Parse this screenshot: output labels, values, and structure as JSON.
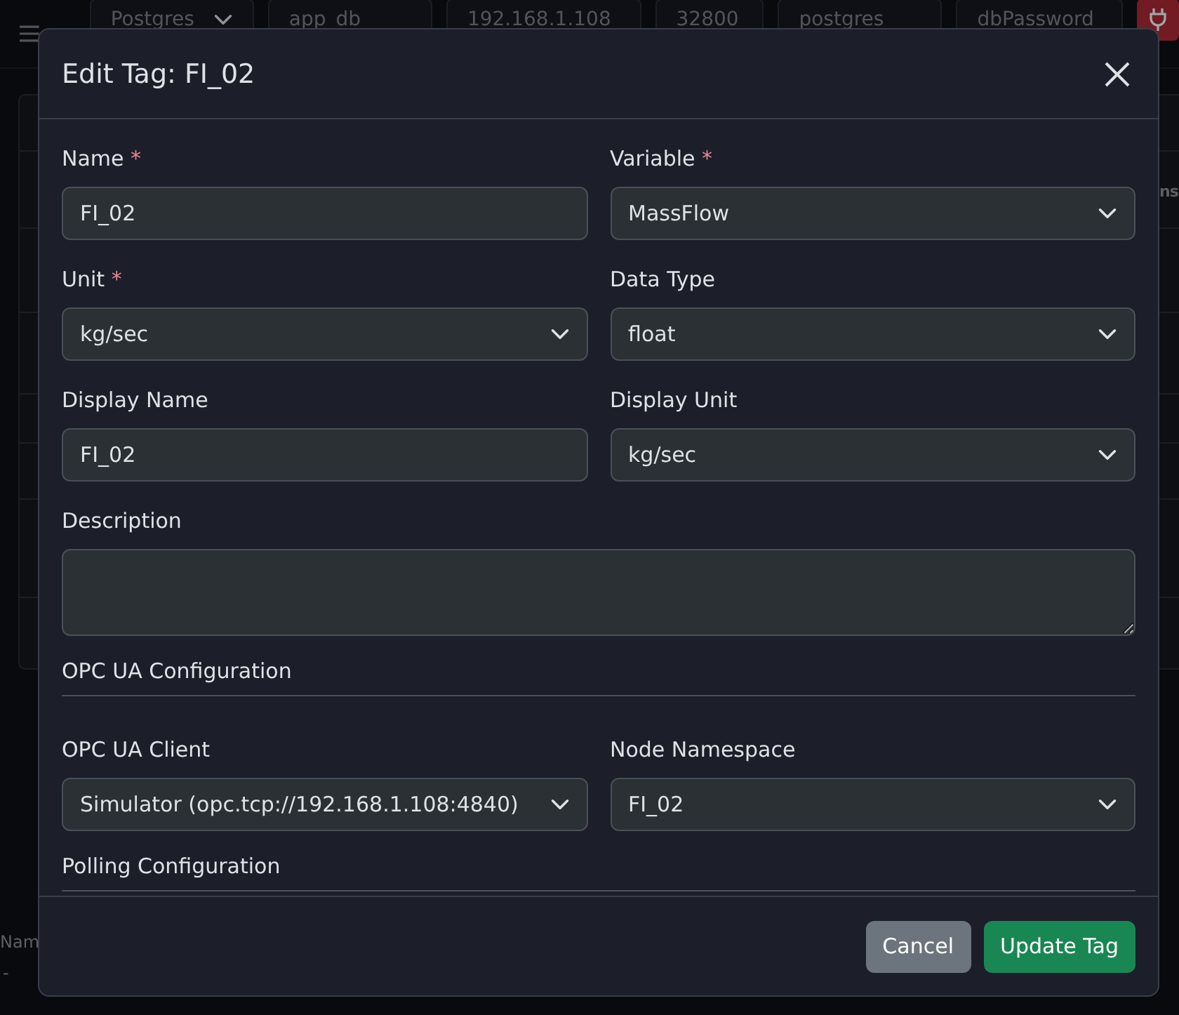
{
  "toolbar": {
    "fields": [
      {
        "kind": "select",
        "value": "Postgres"
      },
      {
        "kind": "input",
        "value": "app_db"
      },
      {
        "kind": "input",
        "value": "192.168.1.108"
      },
      {
        "kind": "input",
        "value": "32800"
      },
      {
        "kind": "input",
        "value": "postgres"
      },
      {
        "kind": "input",
        "value": "dbPassword"
      }
    ]
  },
  "background": {
    "column_header": "ns",
    "table_header": "Nam",
    "table_cell": "-"
  },
  "modal": {
    "title": "Edit Tag: FI_02",
    "required_mark": "*",
    "sections": [
      {
        "fields": [
          {
            "label": "Name",
            "required": true,
            "kind": "input",
            "value": "FI_02"
          },
          {
            "label": "Variable",
            "required": true,
            "kind": "select",
            "value": "MassFlow"
          },
          {
            "label": "Unit",
            "required": true,
            "kind": "select",
            "value": "kg/sec"
          },
          {
            "label": "Data Type",
            "required": false,
            "kind": "select",
            "value": "float"
          },
          {
            "label": "Display Name",
            "required": false,
            "kind": "input",
            "value": "FI_02"
          },
          {
            "label": "Display Unit",
            "required": false,
            "kind": "select",
            "value": "kg/sec"
          },
          {
            "label": "Description",
            "required": false,
            "kind": "textarea"
          }
        ]
      },
      {
        "heading": "OPC UA Configuration",
        "fields": [
          {
            "label": "OPC UA Client",
            "required": false,
            "kind": "select",
            "value": "Simulator (opc.tcp://192.168.1.108:4840)"
          },
          {
            "label": "Node Namespace",
            "required": false,
            "kind": "select",
            "value": "FI_02"
          }
        ]
      },
      {
        "heading": "Polling Configuration"
      }
    ],
    "buttons": [
      {
        "label": "Cancel",
        "kind": "secondary"
      },
      {
        "label": "Update Tag",
        "kind": "primary"
      }
    ]
  }
}
